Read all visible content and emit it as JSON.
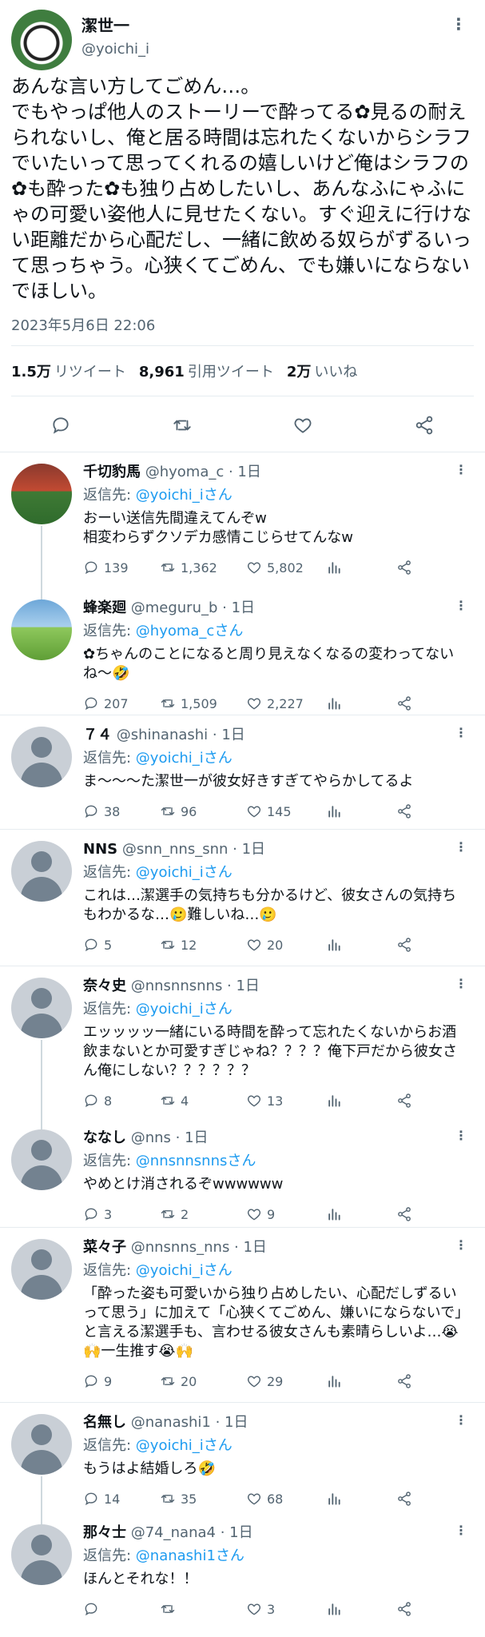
{
  "tweet": {
    "display_name": "潔世一",
    "handle": "@yoichi_i",
    "text": "あんな言い方してごめん…。\nでもやっぱ他人のストーリーで酔ってる✿見るの耐えられないし、俺と居る時間は忘れたくないからシラフでいたいって思ってくれるの嬉しいけど俺はシラフの✿も酔った✿も独り占めしたいし、あんなふにゃふにゃの可愛い姿他人に見せたくない。すぐ迎えに行けない距離だから心配だし、一緒に飲める奴らがずるいって思っちゃう。心狭くてごめん、でも嫌いにならないでほしい。",
    "timestamp": "2023年5月6日 22:06",
    "retweets_count": "1.5万",
    "retweets_label": "リツイート",
    "quotes_count": "8,961",
    "quotes_label": "引用ツイート",
    "likes_count": "2万",
    "likes_label": "いいね"
  },
  "replies": [
    {
      "name": "千切豹馬",
      "meta": "@hyoma_c · 1日",
      "to_prefix": "返信先: ",
      "to_link": "@yoichi_iさん",
      "text": "おーい送信先間違えてんぞw\n相変わらずクソデカ感情こじらせてんなw",
      "reply": "139",
      "retweet": "1,362",
      "like": "5,802"
    },
    {
      "name": "蜂楽廻",
      "meta": "@meguru_b · 1日",
      "to_prefix": "返信先: ",
      "to_link": "@hyoma_cさん",
      "text": "✿ちゃんのことになると周り見えなくなるの変わってないね〜🤣",
      "reply": "207",
      "retweet": "1,509",
      "like": "2,227"
    },
    {
      "name": "７４",
      "meta": "@shinanashi · 1日",
      "to_prefix": "返信先: ",
      "to_link": "@yoichi_iさん",
      "text": "ま〜〜〜た潔世一が彼女好きすぎてやらかしてるよ",
      "reply": "38",
      "retweet": "96",
      "like": "145"
    },
    {
      "name": "NNS",
      "meta": "@snn_nns_snn · 1日",
      "to_prefix": "返信先: ",
      "to_link": "@yoichi_iさん",
      "text": "これは…潔選手の気持ちも分かるけど、彼女さんの気持ちもわかるな…🥲難しいね…🥲",
      "reply": "5",
      "retweet": "12",
      "like": "20"
    },
    {
      "name": "奈々史",
      "meta": "@nnsnnsnns · 1日",
      "to_prefix": "返信先: ",
      "to_link": "@yoichi_iさん",
      "text": "エッッッッ一緒にいる時間を酔って忘れたくないからお酒飲まないとか可愛すぎじゃね？？？？俺下戸だから彼女さん俺にしない？？？？？？",
      "reply": "8",
      "retweet": "4",
      "like": "13"
    },
    {
      "name": "ななし",
      "meta": "@nns · 1日",
      "to_prefix": "返信先: ",
      "to_link": "@nnsnnsnnsさん",
      "text": "やめとけ消されるぞwwwwww",
      "reply": "3",
      "retweet": "2",
      "like": "9"
    },
    {
      "name": "菜々子",
      "meta": "@nnsnns_nns · 1日",
      "to_prefix": "返信先: ",
      "to_link": "@yoichi_iさん",
      "text": "「酔った姿も可愛いから独り占めしたい、心配だしずるいって思う」に加えて「心狭くてごめん、嫌いにならないで」と言える潔選手も、言わせる彼女さんも素晴らしいよ…😭🙌一生推す😭🙌",
      "reply": "9",
      "retweet": "20",
      "like": "29"
    },
    {
      "name": "名無し",
      "meta": "@nanashi1 · 1日",
      "to_prefix": "返信先: ",
      "to_link": "@yoichi_iさん",
      "text": "もうはよ結婚しろ🤣",
      "reply": "14",
      "retweet": "35",
      "like": "68"
    },
    {
      "name": "那々士",
      "meta": "@74_nana4 · 1日",
      "to_prefix": "返信先: ",
      "to_link": "@nanashi1さん",
      "text": "ほんとそれな！！",
      "reply": "",
      "retweet": "",
      "like": "3"
    }
  ],
  "icons": {
    "reply": "speech-bubble-icon",
    "retweet": "retweet-arrows-icon",
    "like": "heart-icon",
    "analytics": "bar-chart-icon",
    "share": "share-icon",
    "more": "three-dots-icon"
  },
  "colors": {
    "link": "#1d9bf0",
    "muted": "#536471",
    "divider": "#e6ecf0"
  }
}
